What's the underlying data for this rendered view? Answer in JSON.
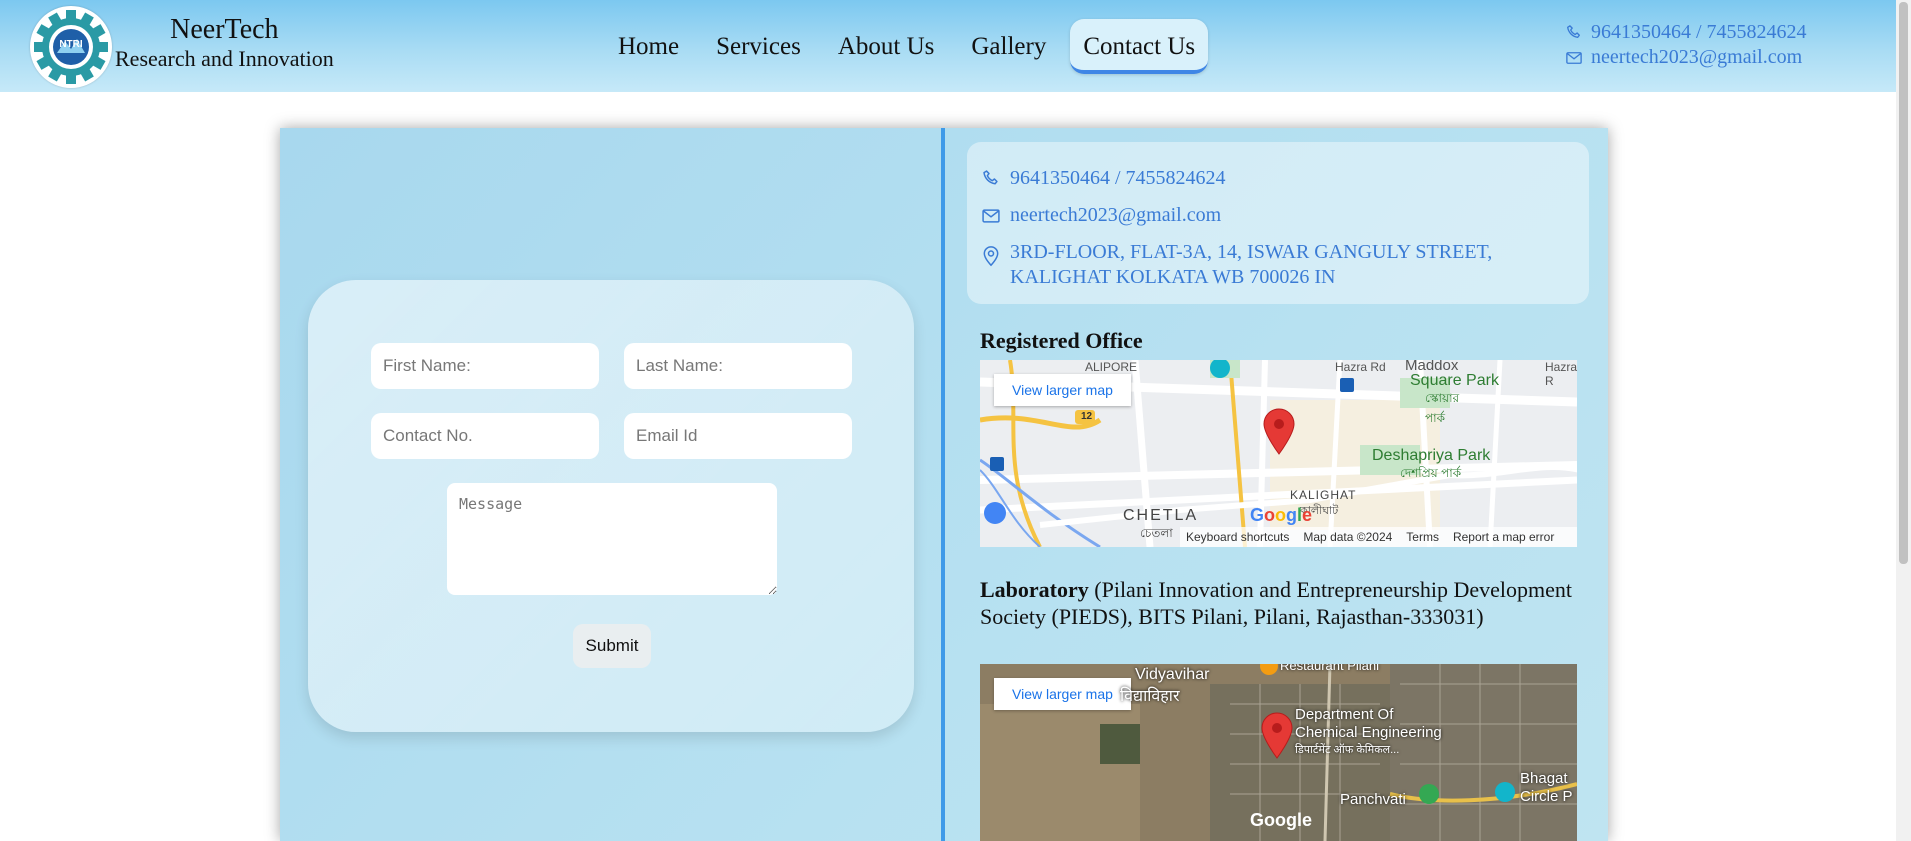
{
  "header": {
    "brand_name": "NeerTech",
    "brand_sub": "Research and Innovation",
    "logo_text": "NTRI",
    "nav": [
      "Home",
      "Services",
      "About Us",
      "Gallery",
      "Contact Us"
    ],
    "active_nav": "Contact Us",
    "phone": "9641350464 / 7455824624",
    "email": "neertech2023@gmail.com"
  },
  "form": {
    "first_name_placeholder": "First Name:",
    "last_name_placeholder": "Last Name:",
    "contact_placeholder": "Contact No.",
    "email_placeholder": "Email Id",
    "message_placeholder": "Message",
    "submit_label": "Submit"
  },
  "info": {
    "phone": "9641350464 / 7455824624",
    "email": "neertech2023@gmail.com",
    "address_line1": "3RD-FLOOR, FLAT-3A, 14, ISWAR GANGULY STREET,",
    "address_line2": "KALIGHAT KOLKATA WB 700026 IN"
  },
  "registered_office": {
    "title": "Registered Office",
    "map_button": "View larger map",
    "labels": {
      "alipore": "ALIPORE",
      "hazra_rd": "Hazra Rd",
      "maddox": "Maddox",
      "square_park": "Square Park",
      "square_park_bn": "স্কোয়ার পার্ক",
      "deshapriya": "Deshapriya Park",
      "deshapriya_bn": "দেশপ্রিয় পার্ক",
      "kalighat": "KALIGHAT",
      "kalighat_bn": "কালীঘাট",
      "chetla": "CHETLA",
      "chetla_bn": "চেতলা",
      "route": "12",
      "hazra_r": "Hazra R"
    },
    "footer": [
      "Keyboard shortcuts",
      "Map data ©2024",
      "Terms",
      "Report a map error"
    ]
  },
  "laboratory": {
    "title": "Laboratory",
    "desc": " (Pilani Innovation and Entrepreneurship Development Society (PIEDS), BITS Pilani, Pilani, Rajasthan-333031)",
    "map_button": "View larger map",
    "labels": {
      "vidyavihar": "Vidyavihar",
      "vidyavihar_hi": "विद्याविहार",
      "restaurant": "Restaurant Pilani",
      "dept1": "Department Of",
      "dept2": "Chemical Engineering",
      "dept_hi": "डिपार्टमेंट ऑफ केमिकल...",
      "panchvati": "Panchvati",
      "bhagat1": "Bhagat",
      "bhagat2": "Circle P"
    }
  },
  "colors": {
    "accent": "#3a7bd5",
    "divider": "#3f9ae8",
    "marker": "#e53935"
  }
}
